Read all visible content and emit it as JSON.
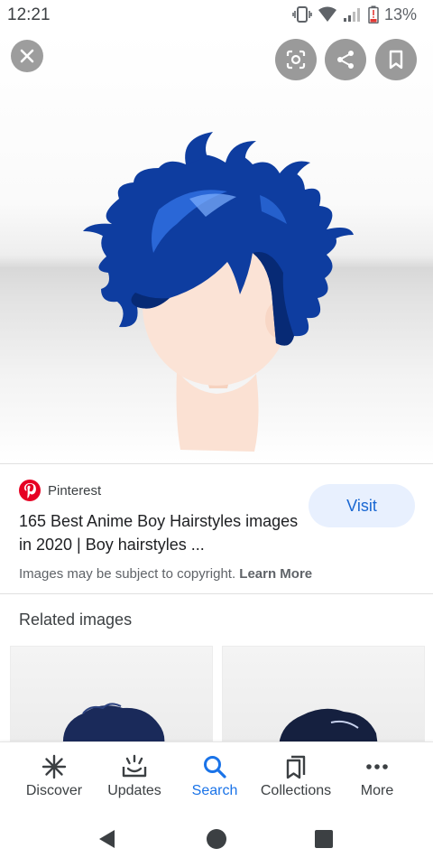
{
  "status_bar": {
    "time": "12:21",
    "battery": "13%",
    "icons": [
      "vibrate-icon",
      "wifi-icon",
      "signal-icon",
      "battery-low-icon"
    ]
  },
  "viewer": {
    "image_subject": "anime boy hairstyle with dark blue hair",
    "buttons": [
      "close-icon",
      "lens-icon",
      "share-icon",
      "bookmark-icon"
    ]
  },
  "result": {
    "source": "Pinterest",
    "title": "165 Best Anime Boy Hairstyles images in 2020 | Boy hairstyles ...",
    "visit_label": "Visit",
    "copyright_text": "Images may be subject to copyright.",
    "learn_more": "Learn More"
  },
  "related": {
    "label": "Related images"
  },
  "bottom_nav": {
    "items": [
      {
        "label": "Discover",
        "icon": "asterisk-icon"
      },
      {
        "label": "Updates",
        "icon": "updates-icon"
      },
      {
        "label": "Search",
        "icon": "search-icon",
        "active": true
      },
      {
        "label": "Collections",
        "icon": "collections-icon"
      },
      {
        "label": "More",
        "icon": "more-dots-icon"
      }
    ]
  },
  "colors": {
    "accent": "#1a73e8",
    "visit_bg": "#e8f0fe",
    "pinterest": "#e60023",
    "hair": "#0d3c9e"
  }
}
